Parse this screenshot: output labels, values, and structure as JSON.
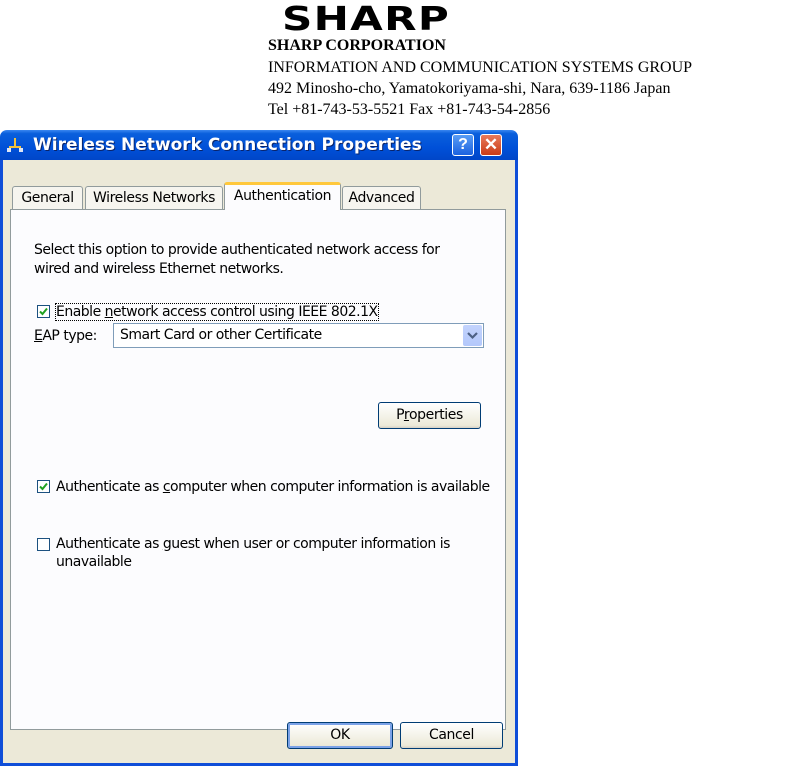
{
  "letterhead": {
    "logo_text": "SHARP",
    "corporation": "SHARP CORPORATION",
    "group": "INFORMATION AND COMMUNICATION SYSTEMS GROUP",
    "address": "492 Minosho-cho, Yamatokoriyama-shi, Nara, 639-1186 Japan",
    "contact": "Tel +81-743-53-5521 Fax +81-743-54-2856"
  },
  "dialog": {
    "title": "Wireless Network Connection Properties",
    "title_icon": "network-connection-icon",
    "help_label": "?",
    "close_label": "✕",
    "tabs": [
      {
        "label": "General",
        "active": false
      },
      {
        "label": "Wireless Networks",
        "active": false
      },
      {
        "label": "Authentication",
        "active": true
      },
      {
        "label": "Advanced",
        "active": false
      }
    ],
    "description_line1": "Select this option to provide authenticated network access for",
    "description_line2": "wired and wireless Ethernet networks.",
    "enable_8021x": {
      "prefix": "Enable ",
      "accel": "n",
      "rest": "etwork access control using IEEE 802.1X",
      "checked": true
    },
    "eap_label": {
      "accel": "E",
      "rest": "AP type:"
    },
    "eap_value": "Smart Card or other Certificate",
    "properties_button": {
      "prefix": "P",
      "accel": "r",
      "rest": "operties"
    },
    "auth_computer": {
      "prefix": "Authenticate as ",
      "accel": "c",
      "rest": "omputer when computer information is available",
      "checked": true
    },
    "auth_guest": {
      "prefix": "Authenticate as ",
      "accel": "g",
      "rest": "uest when user or computer information is",
      "line2": "unavailable",
      "checked": false
    },
    "ok_label": "OK",
    "cancel_label": "Cancel"
  }
}
